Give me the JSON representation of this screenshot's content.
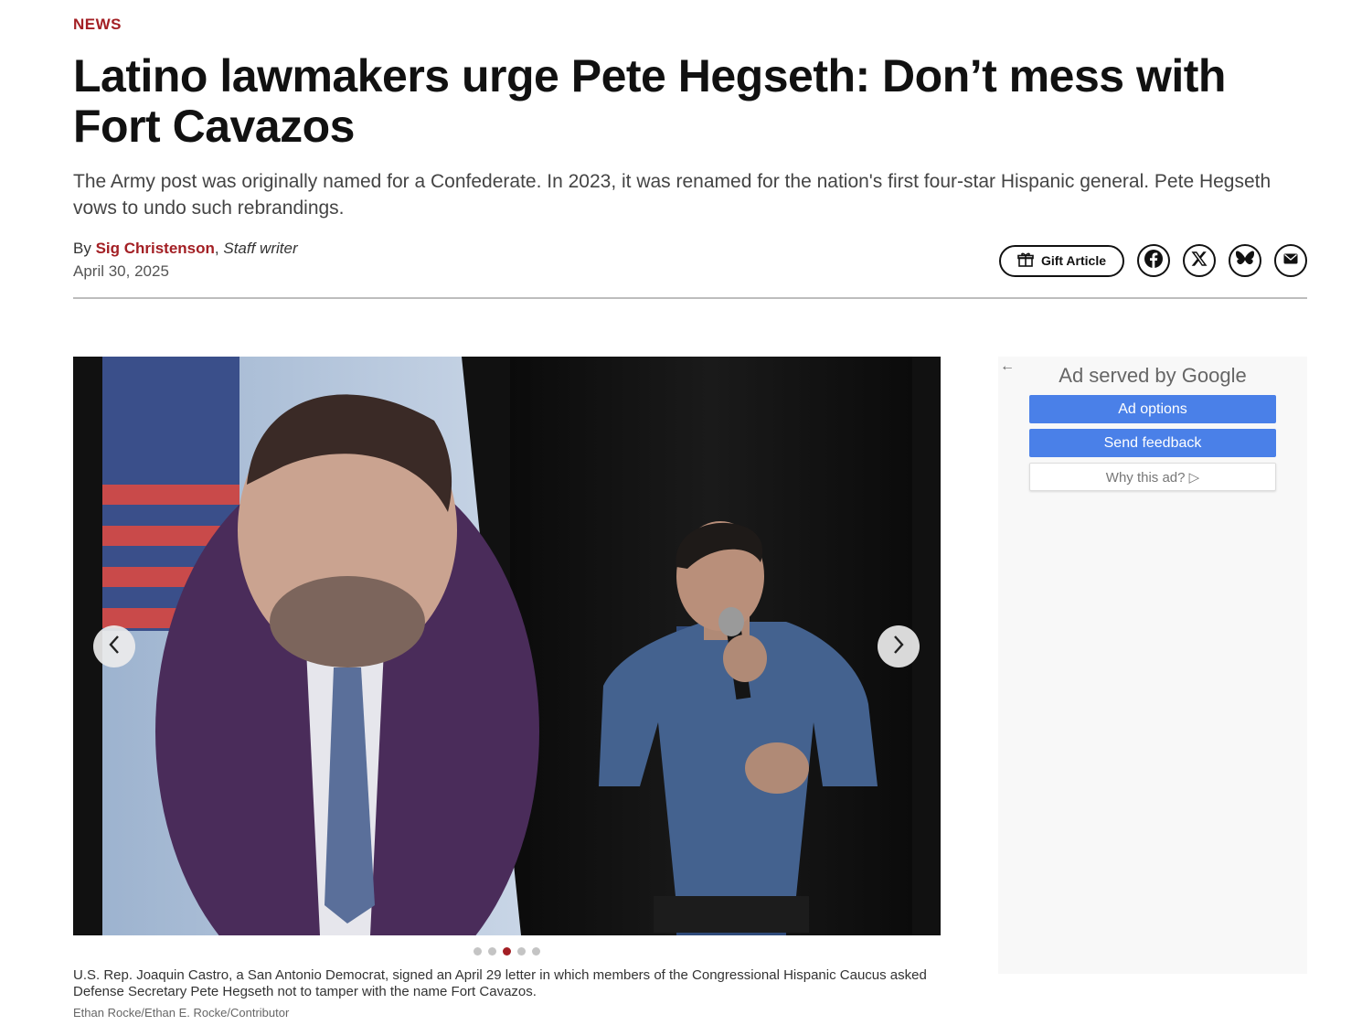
{
  "article": {
    "section": "NEWS",
    "headline": "Latino lawmakers urge Pete Hegseth: Don’t mess with Fort Cavazos",
    "dek": "The Army post was originally named for a Confederate. In 2023, it was renamed for the nation's first four-star Hispanic general. Pete Hegseth vows to undo such rebrandings.",
    "byline_prefix": "By ",
    "author": "Sig Christenson",
    "byline_sep": ", ",
    "author_role": "Staff writer",
    "date": "April 30, 2025"
  },
  "share": {
    "gift_label": "Gift Article",
    "icons": [
      "facebook-icon",
      "x-icon",
      "bluesky-icon",
      "email-icon"
    ]
  },
  "gallery": {
    "total": 5,
    "active_index": 3,
    "caption": "U.S. Rep. Joaquin Castro, a San Antonio Democrat, signed an April 29 letter in which members of the Congressional Hispanic Caucus asked Defense Secretary Pete Hegseth not to tamper with the name Fort Cavazos.",
    "credit": "Ethan Rocke/Ethan E. Rocke/Contributor"
  },
  "ad": {
    "back_icon": "←",
    "title": "Ad served by Google",
    "options_label": "Ad options",
    "feedback_label": "Send feedback",
    "why_label": "Why this ad? ▷"
  },
  "colors": {
    "accent": "#a31f24",
    "ad_blue": "#4a80e8"
  }
}
